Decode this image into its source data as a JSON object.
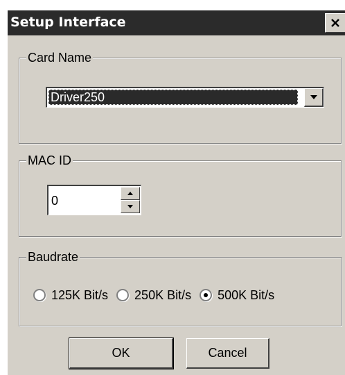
{
  "window": {
    "title": "Setup Interface"
  },
  "card_name": {
    "label": "Card Name",
    "selected": "Driver250"
  },
  "mac_id": {
    "label": "MAC ID",
    "value": "0"
  },
  "baudrate": {
    "label": "Baudrate",
    "options": [
      {
        "label": "125K Bit/s",
        "selected": false
      },
      {
        "label": "250K Bit/s",
        "selected": false
      },
      {
        "label": "500K Bit/s",
        "selected": true
      }
    ]
  },
  "buttons": {
    "ok": "OK",
    "cancel": "Cancel"
  },
  "icons": {
    "close": "close-icon",
    "dropdown": "chevron-down-icon",
    "spin_up": "arrow-up-icon",
    "spin_down": "arrow-down-icon"
  }
}
